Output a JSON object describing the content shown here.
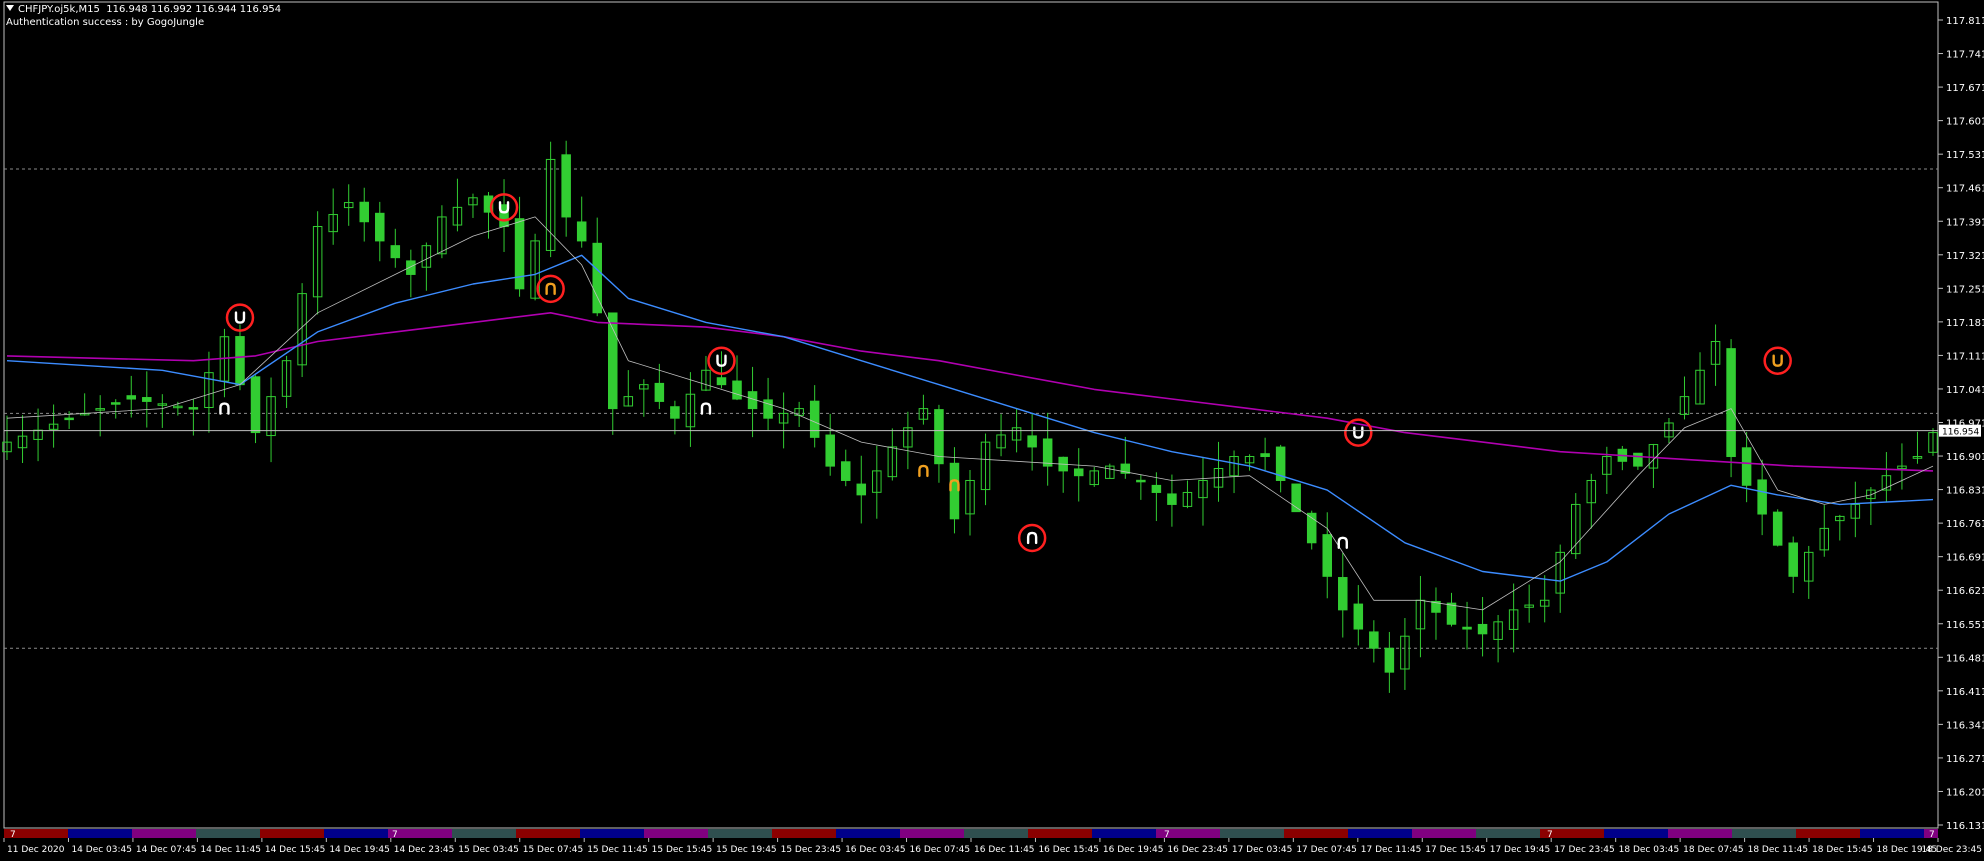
{
  "header": {
    "symbol_line": "CHFJPY.oj5k,M15  116.948 116.992 116.944 116.954",
    "auth_line": "Authentication success : by GogoJungle"
  },
  "colors": {
    "background": "#000000",
    "candle": "#32cd32",
    "ma_fast": "#c0c0c0",
    "ma_mid": "#3c8cff",
    "ma_slow": "#b000b0",
    "signal_circle": "#ff2020",
    "arrow_white": "#ffffff",
    "arrow_orange": "#f0a020"
  },
  "icons": {
    "dropdown": "triangle-down-icon",
    "signal": "horseshoe-arrow-icon"
  },
  "chart_data": {
    "type": "candlestick",
    "y_ticks": [
      "117.811",
      "117.741",
      "117.671",
      "117.601",
      "117.531",
      "117.461",
      "117.391",
      "117.321",
      "117.251",
      "117.181",
      "117.111",
      "117.041",
      "116.971",
      "116.901",
      "116.831",
      "116.761",
      "116.691",
      "116.621",
      "116.551",
      "116.481",
      "116.411",
      "116.341",
      "116.271",
      "116.201",
      "116.131"
    ],
    "ylim": [
      116.131,
      117.811
    ],
    "x_ticks": [
      "11 Dec 2020",
      "14 Dec 03:45",
      "14 Dec 07:45",
      "14 Dec 11:45",
      "14 Dec 15:45",
      "14 Dec 19:45",
      "14 Dec 23:45",
      "15 Dec 03:45",
      "15 Dec 07:45",
      "15 Dec 11:45",
      "15 Dec 15:45",
      "15 Dec 19:45",
      "15 Dec 23:45",
      "16 Dec 03:45",
      "16 Dec 07:45",
      "16 Dec 11:45",
      "16 Dec 15:45",
      "16 Dec 19:45",
      "16 Dec 23:45",
      "17 Dec 03:45",
      "17 Dec 07:45",
      "17 Dec 11:45",
      "17 Dec 15:45",
      "17 Dec 19:45",
      "17 Dec 23:45",
      "18 Dec 03:45",
      "18 Dec 07:45",
      "18 Dec 11:45",
      "18 Dec 15:45",
      "18 Dec 19:45",
      "18 Dec 23:45"
    ],
    "current_price": "116.954",
    "dashed_levels": [
      117.5,
      116.99,
      116.5
    ],
    "price_path": [
      [
        0,
        116.93
      ],
      [
        4,
        116.98
      ],
      [
        8,
        117.02
      ],
      [
        12,
        117.0
      ],
      [
        14,
        117.15
      ],
      [
        16,
        116.95
      ],
      [
        18,
        117.1
      ],
      [
        20,
        117.38
      ],
      [
        22,
        117.43
      ],
      [
        24,
        117.35
      ],
      [
        26,
        117.28
      ],
      [
        28,
        117.4
      ],
      [
        30,
        117.44
      ],
      [
        32,
        117.38
      ],
      [
        33,
        117.25
      ],
      [
        34,
        117.35
      ],
      [
        35,
        117.52
      ],
      [
        36,
        117.4
      ],
      [
        37,
        117.35
      ],
      [
        38,
        117.2
      ],
      [
        39,
        117.0
      ],
      [
        41,
        117.05
      ],
      [
        43,
        116.98
      ],
      [
        45,
        117.08
      ],
      [
        47,
        117.02
      ],
      [
        49,
        116.98
      ],
      [
        51,
        117.0
      ],
      [
        53,
        116.88
      ],
      [
        55,
        116.82
      ],
      [
        57,
        116.92
      ],
      [
        59,
        117.0
      ],
      [
        61,
        116.77
      ],
      [
        63,
        116.93
      ],
      [
        65,
        116.96
      ],
      [
        67,
        116.88
      ],
      [
        69,
        116.86
      ],
      [
        71,
        116.88
      ],
      [
        73,
        116.85
      ],
      [
        75,
        116.8
      ],
      [
        77,
        116.85
      ],
      [
        79,
        116.9
      ],
      [
        81,
        116.9
      ],
      [
        82,
        116.85
      ],
      [
        84,
        116.72
      ],
      [
        86,
        116.58
      ],
      [
        88,
        116.5
      ],
      [
        89,
        116.45
      ],
      [
        91,
        116.6
      ],
      [
        93,
        116.55
      ],
      [
        95,
        116.53
      ],
      [
        97,
        116.58
      ],
      [
        99,
        116.6
      ],
      [
        101,
        116.8
      ],
      [
        103,
        116.9
      ],
      [
        105,
        116.88
      ],
      [
        107,
        116.97
      ],
      [
        109,
        117.08
      ],
      [
        110,
        117.14
      ],
      [
        111,
        116.9
      ],
      [
        113,
        116.78
      ],
      [
        115,
        116.65
      ],
      [
        117,
        116.75
      ],
      [
        119,
        116.8
      ],
      [
        121,
        116.86
      ],
      [
        123,
        116.9
      ],
      [
        124,
        116.95
      ]
    ],
    "ma_fast_path": [
      [
        0,
        116.98
      ],
      [
        10,
        117.0
      ],
      [
        15,
        117.05
      ],
      [
        20,
        117.2
      ],
      [
        25,
        117.28
      ],
      [
        30,
        117.36
      ],
      [
        34,
        117.4
      ],
      [
        37,
        117.3
      ],
      [
        40,
        117.1
      ],
      [
        45,
        117.05
      ],
      [
        50,
        117.0
      ],
      [
        55,
        116.93
      ],
      [
        60,
        116.9
      ],
      [
        65,
        116.89
      ],
      [
        70,
        116.88
      ],
      [
        75,
        116.85
      ],
      [
        80,
        116.86
      ],
      [
        85,
        116.75
      ],
      [
        88,
        116.6
      ],
      [
        91,
        116.6
      ],
      [
        95,
        116.58
      ],
      [
        100,
        116.68
      ],
      [
        105,
        116.86
      ],
      [
        108,
        116.96
      ],
      [
        111,
        117.0
      ],
      [
        114,
        116.83
      ],
      [
        117,
        116.8
      ],
      [
        120,
        116.82
      ],
      [
        124,
        116.88
      ]
    ],
    "ma_mid_path": [
      [
        0,
        117.1
      ],
      [
        10,
        117.08
      ],
      [
        15,
        117.05
      ],
      [
        20,
        117.16
      ],
      [
        25,
        117.22
      ],
      [
        30,
        117.26
      ],
      [
        34,
        117.28
      ],
      [
        37,
        117.32
      ],
      [
        40,
        117.23
      ],
      [
        45,
        117.18
      ],
      [
        50,
        117.15
      ],
      [
        55,
        117.1
      ],
      [
        60,
        117.05
      ],
      [
        65,
        117.0
      ],
      [
        70,
        116.95
      ],
      [
        75,
        116.91
      ],
      [
        80,
        116.88
      ],
      [
        85,
        116.83
      ],
      [
        90,
        116.72
      ],
      [
        95,
        116.66
      ],
      [
        100,
        116.64
      ],
      [
        103,
        116.68
      ],
      [
        107,
        116.78
      ],
      [
        111,
        116.84
      ],
      [
        114,
        116.82
      ],
      [
        118,
        116.8
      ],
      [
        124,
        116.81
      ]
    ],
    "ma_slow_path": [
      [
        0,
        117.11
      ],
      [
        12,
        117.1
      ],
      [
        16,
        117.11
      ],
      [
        20,
        117.14
      ],
      [
        25,
        117.16
      ],
      [
        30,
        117.18
      ],
      [
        35,
        117.2
      ],
      [
        38,
        117.18
      ],
      [
        45,
        117.17
      ],
      [
        50,
        117.15
      ],
      [
        55,
        117.12
      ],
      [
        60,
        117.1
      ],
      [
        65,
        117.07
      ],
      [
        70,
        117.04
      ],
      [
        75,
        117.02
      ],
      [
        80,
        117.0
      ],
      [
        85,
        116.98
      ],
      [
        90,
        116.95
      ],
      [
        95,
        116.93
      ],
      [
        100,
        116.91
      ],
      [
        105,
        116.9
      ],
      [
        110,
        116.89
      ],
      [
        115,
        116.88
      ],
      [
        124,
        116.87
      ]
    ],
    "signals": [
      {
        "i": 15,
        "p": 117.19,
        "c": true,
        "col": "white",
        "down": true
      },
      {
        "i": 32,
        "p": 117.42,
        "c": true,
        "col": "white",
        "down": true
      },
      {
        "i": 35,
        "p": 117.25,
        "c": true,
        "col": "orange",
        "down": false
      },
      {
        "i": 46,
        "p": 117.1,
        "c": true,
        "col": "white",
        "down": true
      },
      {
        "i": 66,
        "p": 116.73,
        "c": true,
        "col": "white",
        "down": false
      },
      {
        "i": 87,
        "p": 116.95,
        "c": true,
        "col": "white",
        "down": true
      },
      {
        "i": 114,
        "p": 117.1,
        "c": true,
        "col": "orange",
        "down": true
      },
      {
        "i": 14,
        "p": 117.0,
        "c": false,
        "col": "white",
        "down": false
      },
      {
        "i": 45,
        "p": 117.0,
        "c": false,
        "col": "white",
        "down": false
      },
      {
        "i": 59,
        "p": 116.87,
        "c": false,
        "col": "orange",
        "down": false
      },
      {
        "i": 61,
        "p": 116.84,
        "c": false,
        "col": "orange",
        "down": false
      },
      {
        "i": 86,
        "p": 116.72,
        "c": false,
        "col": "white",
        "down": false
      }
    ],
    "session_colors": [
      "#8b0000",
      "#00008b",
      "#800080",
      "#2f4f4f"
    ],
    "session_markers": [
      "7",
      "7",
      "7",
      "7",
      "7"
    ]
  }
}
